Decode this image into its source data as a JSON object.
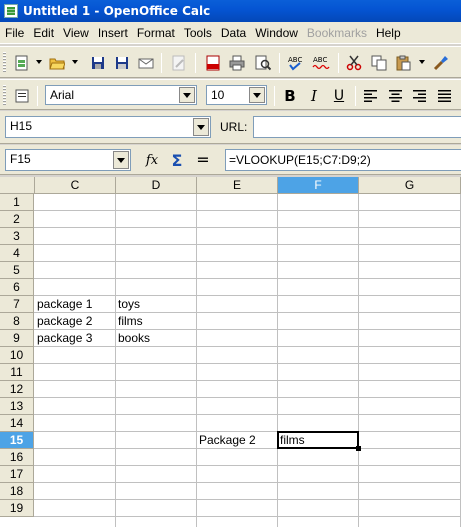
{
  "window": {
    "title": "Untitled 1 - OpenOffice Calc"
  },
  "menu": {
    "items": [
      "File",
      "Edit",
      "View",
      "Insert",
      "Format",
      "Tools",
      "Data",
      "Window",
      "Bookmarks",
      "Help"
    ]
  },
  "format_toolbar": {
    "font_name": "Arial",
    "font_size": "10"
  },
  "hyperlink_bar": {
    "target": "H15",
    "url_label": "URL:",
    "url_value": ""
  },
  "formula_bar": {
    "name_box": "F15",
    "formula": "=VLOOKUP(E15;C7:D9;2)"
  },
  "sheet": {
    "columns": [
      "C",
      "D",
      "E",
      "F",
      "G"
    ],
    "active_column": "F",
    "rows": [
      "1",
      "2",
      "3",
      "4",
      "5",
      "6",
      "7",
      "8",
      "9",
      "10",
      "11",
      "12",
      "13",
      "14",
      "15",
      "16",
      "17",
      "18",
      "19"
    ],
    "active_row": "15",
    "cells": {
      "C7": "package 1",
      "D7": "toys",
      "C8": "package 2",
      "D8": "films",
      "C9": "package 3",
      "D9": "books",
      "E15": "Package 2",
      "F15": "films"
    }
  }
}
